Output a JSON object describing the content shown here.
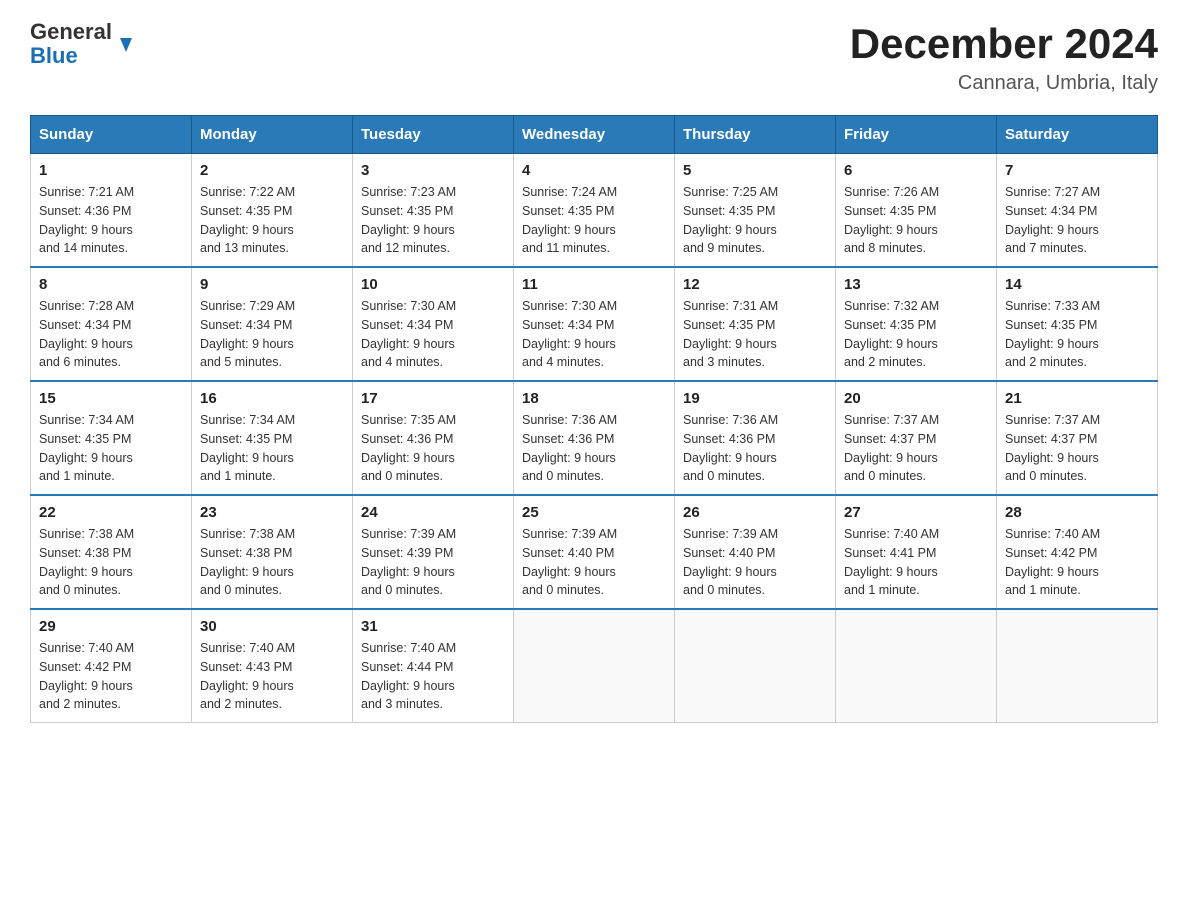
{
  "logo": {
    "general": "General",
    "blue": "Blue"
  },
  "title": "December 2024",
  "location": "Cannara, Umbria, Italy",
  "days_of_week": [
    "Sunday",
    "Monday",
    "Tuesday",
    "Wednesday",
    "Thursday",
    "Friday",
    "Saturday"
  ],
  "weeks": [
    [
      {
        "day": "1",
        "sunrise": "7:21 AM",
        "sunset": "4:36 PM",
        "daylight": "9 hours and 14 minutes."
      },
      {
        "day": "2",
        "sunrise": "7:22 AM",
        "sunset": "4:35 PM",
        "daylight": "9 hours and 13 minutes."
      },
      {
        "day": "3",
        "sunrise": "7:23 AM",
        "sunset": "4:35 PM",
        "daylight": "9 hours and 12 minutes."
      },
      {
        "day": "4",
        "sunrise": "7:24 AM",
        "sunset": "4:35 PM",
        "daylight": "9 hours and 11 minutes."
      },
      {
        "day": "5",
        "sunrise": "7:25 AM",
        "sunset": "4:35 PM",
        "daylight": "9 hours and 9 minutes."
      },
      {
        "day": "6",
        "sunrise": "7:26 AM",
        "sunset": "4:35 PM",
        "daylight": "9 hours and 8 minutes."
      },
      {
        "day": "7",
        "sunrise": "7:27 AM",
        "sunset": "4:34 PM",
        "daylight": "9 hours and 7 minutes."
      }
    ],
    [
      {
        "day": "8",
        "sunrise": "7:28 AM",
        "sunset": "4:34 PM",
        "daylight": "9 hours and 6 minutes."
      },
      {
        "day": "9",
        "sunrise": "7:29 AM",
        "sunset": "4:34 PM",
        "daylight": "9 hours and 5 minutes."
      },
      {
        "day": "10",
        "sunrise": "7:30 AM",
        "sunset": "4:34 PM",
        "daylight": "9 hours and 4 minutes."
      },
      {
        "day": "11",
        "sunrise": "7:30 AM",
        "sunset": "4:34 PM",
        "daylight": "9 hours and 4 minutes."
      },
      {
        "day": "12",
        "sunrise": "7:31 AM",
        "sunset": "4:35 PM",
        "daylight": "9 hours and 3 minutes."
      },
      {
        "day": "13",
        "sunrise": "7:32 AM",
        "sunset": "4:35 PM",
        "daylight": "9 hours and 2 minutes."
      },
      {
        "day": "14",
        "sunrise": "7:33 AM",
        "sunset": "4:35 PM",
        "daylight": "9 hours and 2 minutes."
      }
    ],
    [
      {
        "day": "15",
        "sunrise": "7:34 AM",
        "sunset": "4:35 PM",
        "daylight": "9 hours and 1 minute."
      },
      {
        "day": "16",
        "sunrise": "7:34 AM",
        "sunset": "4:35 PM",
        "daylight": "9 hours and 1 minute."
      },
      {
        "day": "17",
        "sunrise": "7:35 AM",
        "sunset": "4:36 PM",
        "daylight": "9 hours and 0 minutes."
      },
      {
        "day": "18",
        "sunrise": "7:36 AM",
        "sunset": "4:36 PM",
        "daylight": "9 hours and 0 minutes."
      },
      {
        "day": "19",
        "sunrise": "7:36 AM",
        "sunset": "4:36 PM",
        "daylight": "9 hours and 0 minutes."
      },
      {
        "day": "20",
        "sunrise": "7:37 AM",
        "sunset": "4:37 PM",
        "daylight": "9 hours and 0 minutes."
      },
      {
        "day": "21",
        "sunrise": "7:37 AM",
        "sunset": "4:37 PM",
        "daylight": "9 hours and 0 minutes."
      }
    ],
    [
      {
        "day": "22",
        "sunrise": "7:38 AM",
        "sunset": "4:38 PM",
        "daylight": "9 hours and 0 minutes."
      },
      {
        "day": "23",
        "sunrise": "7:38 AM",
        "sunset": "4:38 PM",
        "daylight": "9 hours and 0 minutes."
      },
      {
        "day": "24",
        "sunrise": "7:39 AM",
        "sunset": "4:39 PM",
        "daylight": "9 hours and 0 minutes."
      },
      {
        "day": "25",
        "sunrise": "7:39 AM",
        "sunset": "4:40 PM",
        "daylight": "9 hours and 0 minutes."
      },
      {
        "day": "26",
        "sunrise": "7:39 AM",
        "sunset": "4:40 PM",
        "daylight": "9 hours and 0 minutes."
      },
      {
        "day": "27",
        "sunrise": "7:40 AM",
        "sunset": "4:41 PM",
        "daylight": "9 hours and 1 minute."
      },
      {
        "day": "28",
        "sunrise": "7:40 AM",
        "sunset": "4:42 PM",
        "daylight": "9 hours and 1 minute."
      }
    ],
    [
      {
        "day": "29",
        "sunrise": "7:40 AM",
        "sunset": "4:42 PM",
        "daylight": "9 hours and 2 minutes."
      },
      {
        "day": "30",
        "sunrise": "7:40 AM",
        "sunset": "4:43 PM",
        "daylight": "9 hours and 2 minutes."
      },
      {
        "day": "31",
        "sunrise": "7:40 AM",
        "sunset": "4:44 PM",
        "daylight": "9 hours and 3 minutes."
      },
      null,
      null,
      null,
      null
    ]
  ],
  "labels": {
    "sunrise": "Sunrise:",
    "sunset": "Sunset:",
    "daylight": "Daylight:"
  }
}
